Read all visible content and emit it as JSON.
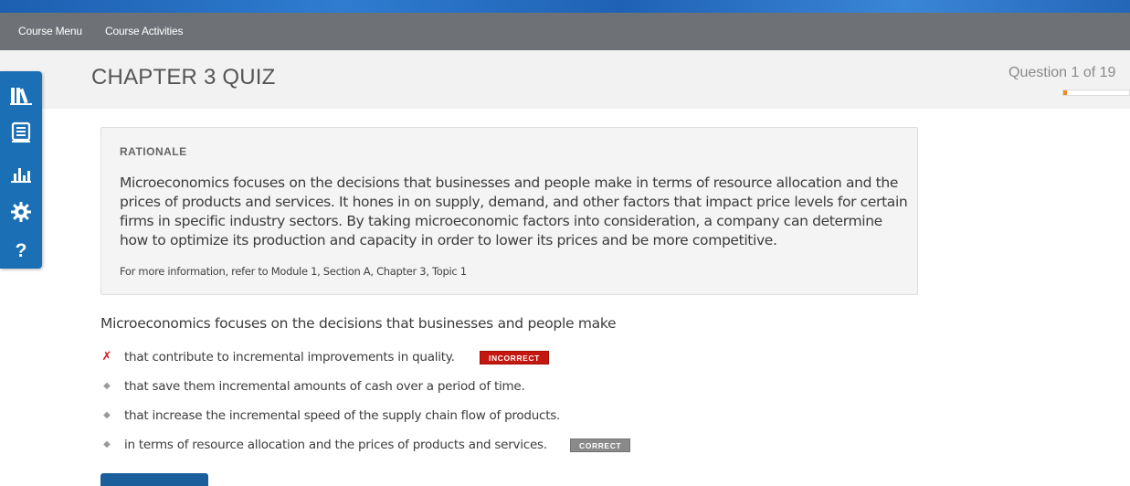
{
  "nav": {
    "course_menu": "Course Menu",
    "course_activities": "Course Activities"
  },
  "header": {
    "title": "CHAPTER 3 QUIZ",
    "counter": "Question 1 of 19",
    "progress_fraction": 0.0526
  },
  "toolbar": {
    "items": [
      "library-icon",
      "notebook-icon",
      "chart-icon",
      "settings-icon",
      "help-icon"
    ],
    "help_glyph": "?"
  },
  "rationale": {
    "heading": "RATIONALE",
    "body": "Microeconomics focuses on the decisions that businesses and people make in terms of resource allocation and the prices of products and services. It hones in on supply, demand, and other factors that impact price levels for certain firms in specific industry sectors. By taking microeconomic factors into consideration, a company can determine how to optimize its production and capacity in order to lower its prices and be more competitive.",
    "reference": "For more information, refer to Module 1, Section A, Chapter 3, Topic 1"
  },
  "question": {
    "stem": "Microeconomics focuses on the decisions that businesses and people make",
    "options": [
      {
        "text": "that contribute to incremental improvements in quality.",
        "marker": "✗",
        "badge": "INCORRECT"
      },
      {
        "text": "that save them incremental amounts of cash over a period of time.",
        "marker": "◆",
        "badge": ""
      },
      {
        "text": "that increase the incremental speed of the supply chain flow of products.",
        "marker": "◆",
        "badge": ""
      },
      {
        "text": "in terms of resource allocation and the prices of products and services.",
        "marker": "◆",
        "badge": "CORRECT"
      }
    ]
  },
  "colors": {
    "accent_blue": "#1a6fb5",
    "progress_orange": "#f08a1c",
    "incorrect_red": "#c4170f",
    "correct_gray": "#8a8a8a"
  }
}
